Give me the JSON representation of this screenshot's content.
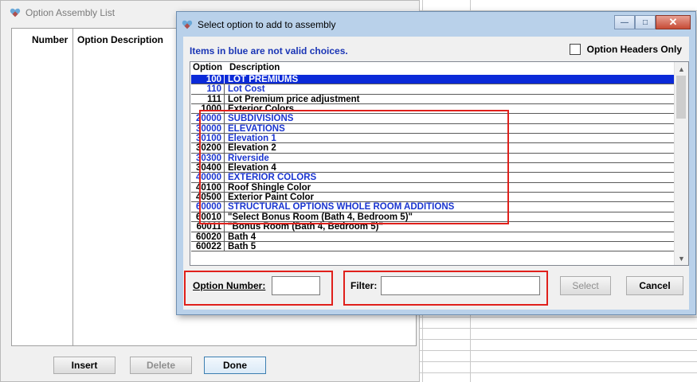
{
  "background_window": {
    "title": "Option Assembly List",
    "columns": [
      "Number",
      "Option Description"
    ],
    "buttons": {
      "insert": "Insert",
      "delete": "Delete",
      "done": "Done"
    }
  },
  "dialog": {
    "title": "Select option to add to assembly",
    "note": "Items in blue are not valid choices.",
    "option_headers_only": {
      "label": "Option Headers Only",
      "checked": false
    },
    "list": {
      "columns": [
        "Option",
        "Description"
      ],
      "rows": [
        {
          "option": "100",
          "description": "LOT PREMIUMS",
          "state": "selected"
        },
        {
          "option": "110",
          "description": "Lot Cost",
          "state": "invalid"
        },
        {
          "option": "111",
          "description": "Lot Premium price adjustment",
          "state": "valid"
        },
        {
          "option": "1000",
          "description": "Exterior Colors",
          "state": "valid"
        },
        {
          "option": "20000",
          "description": "SUBDIVISIONS",
          "state": "invalid"
        },
        {
          "option": "30000",
          "description": "ELEVATIONS",
          "state": "invalid"
        },
        {
          "option": "30100",
          "description": "Elevation 1",
          "state": "invalid"
        },
        {
          "option": "30200",
          "description": "Elevation 2",
          "state": "valid"
        },
        {
          "option": "30300",
          "description": "Riverside",
          "state": "invalid"
        },
        {
          "option": "30400",
          "description": "Elevation 4",
          "state": "valid"
        },
        {
          "option": "40000",
          "description": "EXTERIOR COLORS",
          "state": "invalid"
        },
        {
          "option": "40100",
          "description": "Roof Shingle Color",
          "state": "valid"
        },
        {
          "option": "40500",
          "description": "Exterior Paint Color",
          "state": "valid"
        },
        {
          "option": "60000",
          "description": "STRUCTURAL OPTIONS WHOLE ROOM ADDITIONS",
          "state": "invalid"
        },
        {
          "option": "60010",
          "description": "\"Select Bonus Room (Bath 4, Bedroom 5)\"",
          "state": "valid"
        },
        {
          "option": "60011",
          "description": "\"Bonus Room (Bath 4, Bedroom 5)\"",
          "state": "valid"
        },
        {
          "option": "60020",
          "description": "Bath 4",
          "state": "valid"
        },
        {
          "option": "60022",
          "description": "Bath 5",
          "state": "valid"
        }
      ]
    },
    "option_number_label": "Option Number:",
    "option_number_value": "",
    "filter_label": "Filter:",
    "filter_value": "",
    "buttons": {
      "select": "Select",
      "cancel": "Cancel"
    }
  },
  "colors": {
    "invalid_text": "#1a35d0",
    "selection": "#0b2ad8",
    "highlight_box": "#e0201b"
  }
}
